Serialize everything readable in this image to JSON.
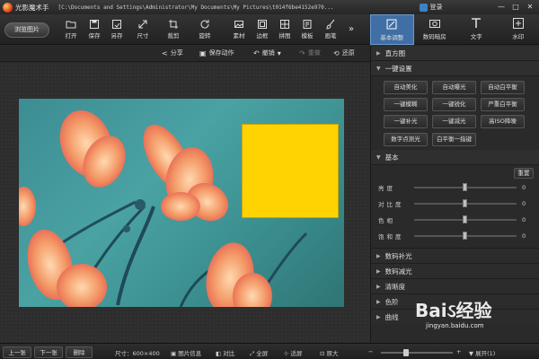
{
  "titlebar": {
    "app_name": "光影魔术手",
    "path": "[C:\\Documents and Settings\\Administrator\\My Documents\\My Pictures\\t014f6be4152e970...",
    "login": "登录",
    "min": "—",
    "max": "□",
    "close": "✕"
  },
  "toolbar": {
    "browse": "浏览图片",
    "tools": [
      {
        "label": "打开",
        "icon": "folder-icon"
      },
      {
        "label": "保存",
        "icon": "save-icon"
      },
      {
        "label": "另存",
        "icon": "save-as-icon"
      },
      {
        "label": "尺寸",
        "icon": "resize-icon"
      },
      {
        "label": "裁剪",
        "icon": "crop-icon"
      },
      {
        "label": "旋转",
        "icon": "rotate-icon"
      },
      {
        "label": "素材",
        "icon": "material-icon"
      },
      {
        "label": "边框",
        "icon": "frame-icon"
      },
      {
        "label": "拼图",
        "icon": "collage-icon"
      },
      {
        "label": "模板",
        "icon": "template-icon"
      },
      {
        "label": "画笔",
        "icon": "brush-icon"
      }
    ],
    "more": "»",
    "right_tabs": [
      {
        "label": "基本调整",
        "icon": "adjust-icon"
      },
      {
        "label": "数码暗房",
        "icon": "camera-icon"
      },
      {
        "label": "文字",
        "icon": "text-icon"
      },
      {
        "label": "水印",
        "icon": "watermark-icon"
      }
    ]
  },
  "actionbar": {
    "share": "分享",
    "save_action": "保存动作",
    "undo": "撤销",
    "redo": "重做",
    "restore": "还原"
  },
  "panel": {
    "histogram": "直方图",
    "one_click": "一键设置",
    "buttons": [
      "自动美化",
      "自动曝光",
      "自动白平衡",
      "一键模糊",
      "一键锐化",
      "严重白平衡",
      "一键补光",
      "一键减光",
      "高ISO降噪"
    ],
    "buttons_row2": [
      "数字点测光",
      "白平衡一指键"
    ],
    "basic": "基本",
    "reset": "重置",
    "sliders": [
      {
        "label": "亮度",
        "value": "0",
        "level": 0.5
      },
      {
        "label": "对比度",
        "value": "0",
        "level": 0.5
      },
      {
        "label": "色相",
        "value": "0",
        "level": 0.5
      },
      {
        "label": "饱和度",
        "value": "0",
        "level": 0.5
      }
    ],
    "collapsed": [
      "数码补光",
      "数码减光",
      "清晰度",
      "色阶",
      "曲线"
    ]
  },
  "statusbar": {
    "prev": "上一张",
    "next": "下一张",
    "delete": "删除",
    "size": "尺寸：600×400",
    "info": "图片信息",
    "compare": "对比",
    "fullscreen": "全屏",
    "fit": "适屏",
    "original": "原大",
    "zoom": "展开(1)",
    "zoom_level": 0.35
  },
  "watermark": {
    "brand": "Baiઽ经验",
    "url": "jingyan.baidu.com"
  },
  "colors": {
    "accent": "#3f6fa5",
    "overlay": "#ffd302"
  }
}
